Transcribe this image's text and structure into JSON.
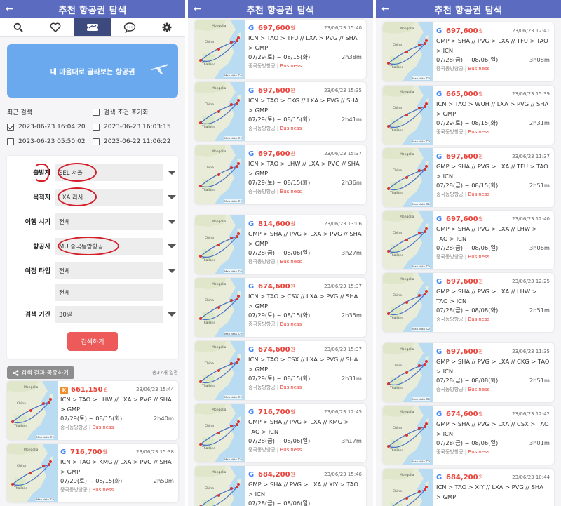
{
  "header": {
    "title": "추천 항공권 탐색",
    "back": "←"
  },
  "tabs": [
    {
      "icon": "search-icon"
    },
    {
      "icon": "heart-icon"
    },
    {
      "icon": "ticket-icon"
    },
    {
      "icon": "chat-icon"
    },
    {
      "icon": "gear-icon"
    }
  ],
  "banner": {
    "text": "내 마음대로 골라보는 항공권"
  },
  "recent": {
    "label": "최근 검색",
    "reset_label": "검색 조건 초기화",
    "items": [
      {
        "text": "2023-06-23 16:04:20",
        "checked": true
      },
      {
        "text": "2023-06-23 16:03:15",
        "checked": false
      },
      {
        "text": "2023-06-23 05:50:02",
        "checked": false
      },
      {
        "text": "2023-06-22 11:06:22",
        "checked": false
      }
    ]
  },
  "form": {
    "departure": {
      "label": "출발지",
      "value": "SEL 서울"
    },
    "destination": {
      "label": "목적지",
      "value": "LXA 라사"
    },
    "travel_time": {
      "label": "여행 시기",
      "value": "전체"
    },
    "airline": {
      "label": "항공사",
      "value": "MU 중국동방항공"
    },
    "trip_type": {
      "label": "여정 타입",
      "value": "전체",
      "value2": "전체"
    },
    "period": {
      "label": "검색 기간",
      "value": "30일"
    },
    "search_button": "검색하기"
  },
  "share": {
    "button": "검색 결과 공유하기",
    "total": "총37개 일정"
  },
  "map_labels": {
    "mongolia": "Mongolia",
    "china": "China",
    "thailand": "Thailand",
    "footer": "Map data ©2"
  },
  "won": "원",
  "cards_p1": [
    {
      "source": "K",
      "price": "661,150",
      "time": "23/06/23 15:44",
      "route": "ICN > TAO > LHW // LXA > PVG // SHA > GMP",
      "dates": "07/29(토) ~ 08/15(화)",
      "duration": "2h40m",
      "airline": "중국동방항공",
      "class": "Business"
    },
    {
      "source": "G",
      "price": "716,700",
      "time": "23/06/23 15:38",
      "route": "ICN > TAO > KMG // LXA > PVG // SHA > GMP",
      "dates": "07/29(토) ~ 08/15(화)",
      "duration": "2h50m",
      "airline": "중국동방항공",
      "class": "Business"
    }
  ],
  "cards_p2": [
    {
      "source": "G",
      "price": "697,600",
      "time": "23/06/23 15:40",
      "route": "ICN > TAO > TFU // LXA > PVG // SHA > GMP",
      "dates": "07/29(토) ~ 08/15(화)",
      "duration": "2h38m",
      "airline": "중국동방항공",
      "class": "Business"
    },
    {
      "source": "G",
      "price": "697,600",
      "time": "23/06/23 15:35",
      "route": "ICN > TAO > CKG // LXA > PVG // SHA > GMP",
      "dates": "07/29(토) ~ 08/15(화)",
      "duration": "2h41m",
      "airline": "중국동방항공",
      "class": "Business"
    },
    {
      "source": "G",
      "price": "697,600",
      "time": "23/06/23 15:37",
      "route": "ICN > TAO > LHW // LXA > PVG // SHA > GMP",
      "dates": "07/29(토) ~ 08/15(화)",
      "duration": "2h36m",
      "airline": "중국동방항공",
      "class": "Business"
    },
    {
      "source": "G",
      "price": "814,600",
      "time": "23/06/23 13:06",
      "route": "GMP > SHA // PVG > LXA > PVG // SHA > GMP",
      "dates": "07/28(금) ~ 08/06(일)",
      "duration": "3h27m",
      "airline": "중국동방항공",
      "class": "Business"
    },
    {
      "source": "G",
      "price": "674,600",
      "time": "23/06/23 15:37",
      "route": "ICN > TAO > CSX // LXA > PVG // SHA > GMP",
      "dates": "07/29(토) ~ 08/15(화)",
      "duration": "2h35m",
      "airline": "중국동방항공",
      "class": "Business"
    },
    {
      "source": "G",
      "price": "674,600",
      "time": "23/06/23 15:37",
      "route": "ICN > TAO > CSX // LXA > PVG // SHA > GMP",
      "dates": "07/29(토) ~ 08/15(화)",
      "duration": "2h31m",
      "airline": "중국동방항공",
      "class": "Business"
    },
    {
      "source": "G",
      "price": "716,700",
      "time": "23/06/23 12:45",
      "route": "GMP > SHA // PVG > LXA // KMG > TAO > ICN",
      "dates": "07/28(금) ~ 08/06(일)",
      "duration": "3h17m",
      "airline": "중국동방항공",
      "class": "Business"
    },
    {
      "source": "G",
      "price": "684,200",
      "time": "23/06/23 15:46",
      "route": "GMP > SHA // PVG > LXA // XIY > TAO > ICN",
      "dates": "07/28(금) ~ 08/06(일)",
      "duration": "",
      "airline": "",
      "class": ""
    }
  ],
  "cards_p3": [
    {
      "source": "G",
      "price": "697,600",
      "time": "23/06/23 12:41",
      "route": "GMP > SHA // PVG > LXA // TFU > TAO > ICN",
      "dates": "07/28(금) ~ 08/06(일)",
      "duration": "3h08m",
      "airline": "중국동방항공",
      "class": "Business"
    },
    {
      "source": "G",
      "price": "665,000",
      "time": "23/06/23 15:39",
      "route": "ICN > TAO > WUH // LXA > PVG // SHA > GMP",
      "dates": "07/29(토) ~ 08/15(화)",
      "duration": "2h31m",
      "airline": "중국동방항공",
      "class": "Business"
    },
    {
      "source": "G",
      "price": "697,600",
      "time": "23/06/23 11:37",
      "route": "GMP > SHA // PVG > LXA // TFU > TAO > ICN",
      "dates": "07/28(금) ~ 08/15(화)",
      "duration": "2h51m",
      "airline": "중국동방항공",
      "class": "Business"
    },
    {
      "source": "G",
      "price": "697,600",
      "time": "23/06/23 12:40",
      "route": "GMP > SHA // PVG > LXA // LHW > TAO > ICN",
      "dates": "07/28(금) ~ 08/06(일)",
      "duration": "3h06m",
      "airline": "중국동방항공",
      "class": "Business"
    },
    {
      "source": "G",
      "price": "697,600",
      "time": "23/06/23 12:25",
      "route": "GMP > SHA // PVG > LXA // LHW > TAO > ICN",
      "dates": "07/28(금) ~ 08/08(화)",
      "duration": "2h51m",
      "airline": "중국동방항공",
      "class": "Business"
    },
    {
      "source": "G",
      "price": "697,600",
      "time": "23/06/23 11:35",
      "route": "GMP > SHA // PVG > LXA // CKG > TAO > ICN",
      "dates": "07/28(금) ~ 08/08(화)",
      "duration": "2h51m",
      "airline": "중국동방항공",
      "class": "Business"
    },
    {
      "source": "G",
      "price": "674,600",
      "time": "23/06/23 12:42",
      "route": "GMP > SHA // PVG > LXA // CSX > TAO > ICN",
      "dates": "07/28(금) ~ 08/06(일)",
      "duration": "3h01m",
      "airline": "중국동방항공",
      "class": "Business"
    },
    {
      "source": "G",
      "price": "684,200",
      "time": "23/06/23 10:44",
      "route": "ICN > TAO > XIY // LXA > PVG // SHA > GMP",
      "dates": "",
      "duration": "",
      "airline": "",
      "class": ""
    }
  ]
}
